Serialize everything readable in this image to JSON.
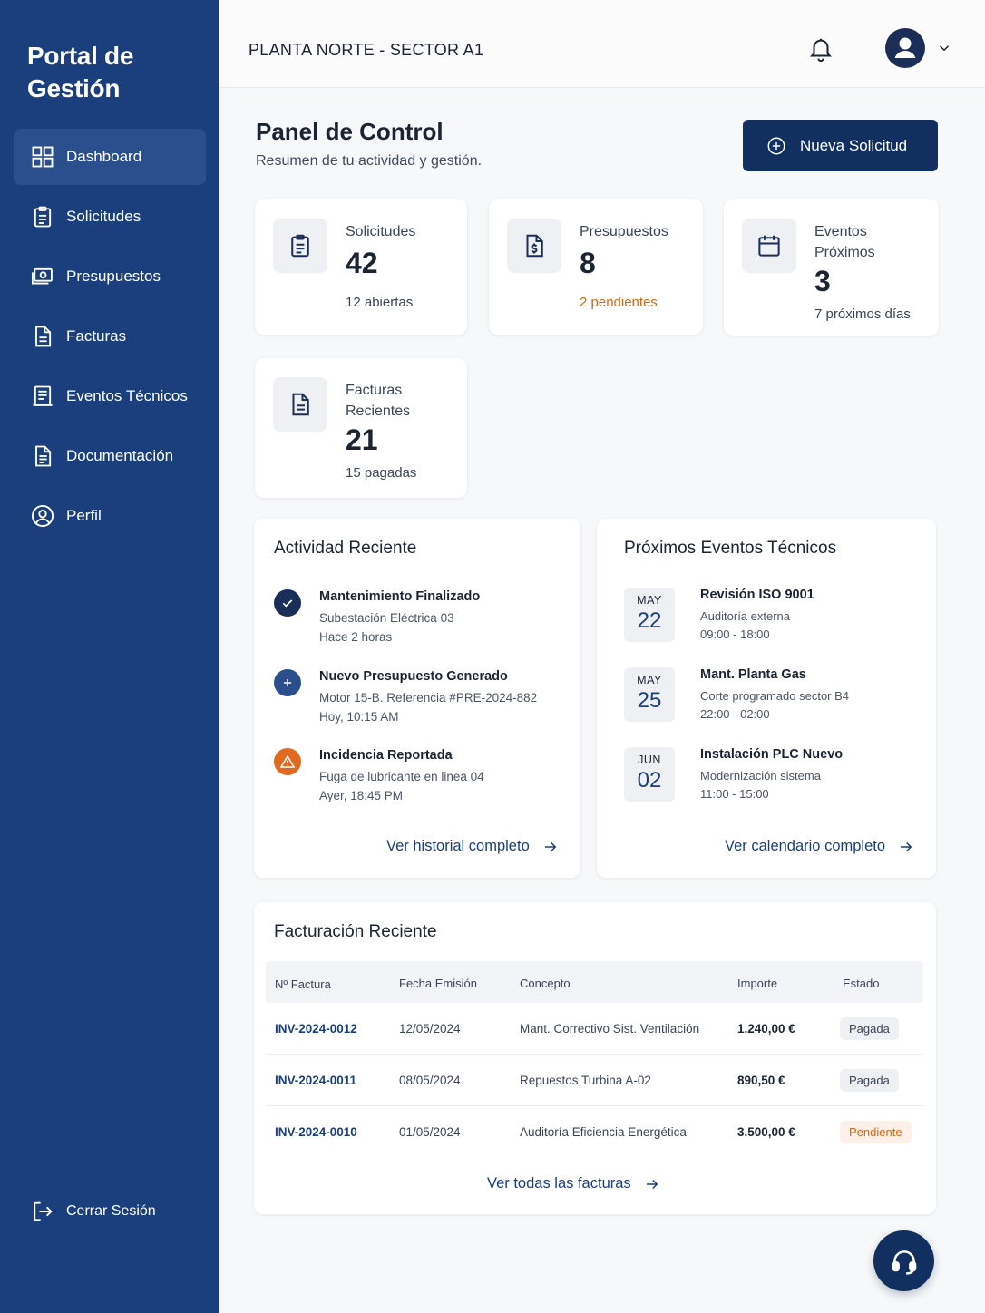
{
  "sidebar": {
    "brand": "Portal de Gestión",
    "items": [
      {
        "label": "Dashboard",
        "icon": "grid-icon"
      },
      {
        "label": "Solicitudes",
        "icon": "clipboard-icon"
      },
      {
        "label": "Presupuestos",
        "icon": "cash-icon"
      },
      {
        "label": "Facturas",
        "icon": "document-icon"
      },
      {
        "label": "Eventos Técnicos",
        "icon": "checklist-icon"
      },
      {
        "label": "Documentación",
        "icon": "document-text-icon"
      },
      {
        "label": "Perfil",
        "icon": "user-circle-icon"
      }
    ],
    "active_item": "Dashboard",
    "logout_label": "Cerrar Sesión"
  },
  "topbar": {
    "location": "PLANTA NORTE - SECTOR A1"
  },
  "header": {
    "title": "Panel de Control",
    "subtitle": "Resumen de tu actividad y gestión.",
    "new_button": "Nueva Solicitud"
  },
  "stats": [
    {
      "label": "Solicitudes",
      "value": "42",
      "sub": "12 abiertas"
    },
    {
      "label": "Presupuestos",
      "value": "8",
      "sub": "2 pendientes"
    },
    {
      "label": "Eventos Próximos",
      "value": "3",
      "sub": "7 próximos días"
    },
    {
      "label": "Facturas Recientes",
      "value": "21",
      "sub": "15 pagadas"
    }
  ],
  "activity": {
    "title": "Actividad Reciente",
    "items": [
      {
        "title": "Mantenimiento Finalizado",
        "detail": "Subestación Eléctrica 03",
        "time": "Hace 2 horas",
        "status": "done"
      },
      {
        "title": "Nuevo Presupuesto Generado",
        "detail": "Motor 15-B. Referencia #PRE-2024-882",
        "time": "Hoy, 10:15 AM",
        "status": "new"
      },
      {
        "title": "Incidencia Reportada",
        "detail": "Fuga de lubricante en linea 04",
        "time": "Ayer, 18:45 PM",
        "status": "warning"
      }
    ],
    "link": "Ver historial completo"
  },
  "events": {
    "title": "Próximos Eventos Técnicos",
    "items": [
      {
        "month": "MAY",
        "day": "22",
        "title": "Revisión ISO 9001",
        "detail": "Auditoría externa",
        "time": "09:00 - 18:00"
      },
      {
        "month": "MAY",
        "day": "25",
        "title": "Mant. Planta Gas",
        "detail": "Corte programado sector B4",
        "time": "22:00 - 02:00"
      },
      {
        "month": "JUN",
        "day": "02",
        "title": "Instalación PLC Nuevo",
        "detail": "Modernización sistema",
        "time": "11:00 - 15:00"
      }
    ],
    "link": "Ver calendario completo"
  },
  "billing": {
    "title": "Facturación Reciente",
    "columns": [
      "Nº Factura",
      "Fecha Emisión",
      "Concepto",
      "Importe",
      "Estado"
    ],
    "rows": [
      {
        "invoice": "INV-2024-0012",
        "date": "12/05/2024",
        "concept": "Mant. Correctivo Sist. Ventilación",
        "amount": "1.240,00 €",
        "status": "Pagada"
      },
      {
        "invoice": "INV-2024-0011",
        "date": "08/05/2024",
        "concept": "Repuestos Turbina A-02",
        "amount": "890,50 €",
        "status": "Pagada"
      },
      {
        "invoice": "INV-2024-0010",
        "date": "01/05/2024",
        "concept": "Auditoría Eficiencia Energética",
        "amount": "3.500,00 €",
        "status": "Pendiente"
      }
    ],
    "link": "Ver todas las facturas"
  },
  "colors": {
    "sidebar": "#1b3f7d",
    "primary": "#12305f",
    "accent_orange": "#d46814"
  }
}
